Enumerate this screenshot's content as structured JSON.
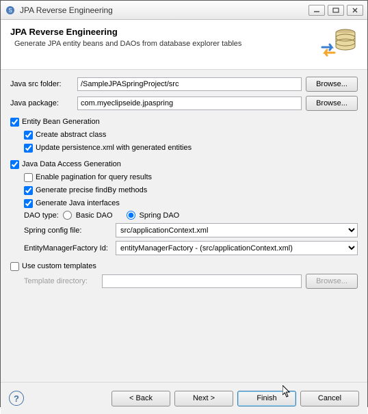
{
  "window": {
    "title": "JPA Reverse Engineering"
  },
  "header": {
    "title": "JPA Reverse Engineering",
    "subtitle": "Generate JPA entity beans and DAOs from database explorer tables"
  },
  "src": {
    "label": "Java src folder:",
    "value": "/SampleJPASpringProject/src",
    "browse": "Browse..."
  },
  "pkg": {
    "label": "Java package:",
    "value": "com.myeclipseide.jpaspring",
    "browse": "Browse..."
  },
  "ebg": {
    "top": "Entity Bean Generation",
    "abstract": "Create abstract class",
    "persist": "Update persistence.xml with generated entities"
  },
  "jda": {
    "top": "Java Data Access Generation",
    "pagination": "Enable pagination for query results",
    "findby": "Generate precise findBy methods",
    "ifaces": "Generate Java interfaces",
    "daoLabel": "DAO type:",
    "basic": "Basic DAO",
    "spring": "Spring DAO",
    "cfgLabel": "Spring config file:",
    "cfgValue": "src/applicationContext.xml",
    "emfLabel": "EntityManagerFactory Id:",
    "emfValue": "entityManagerFactory - (src/applicationContext.xml)"
  },
  "tpl": {
    "use": "Use custom templates",
    "dirLabel": "Template directory:",
    "browse": "Browse..."
  },
  "buttons": {
    "back": "< Back",
    "next": "Next >",
    "finish": "Finish",
    "cancel": "Cancel"
  }
}
